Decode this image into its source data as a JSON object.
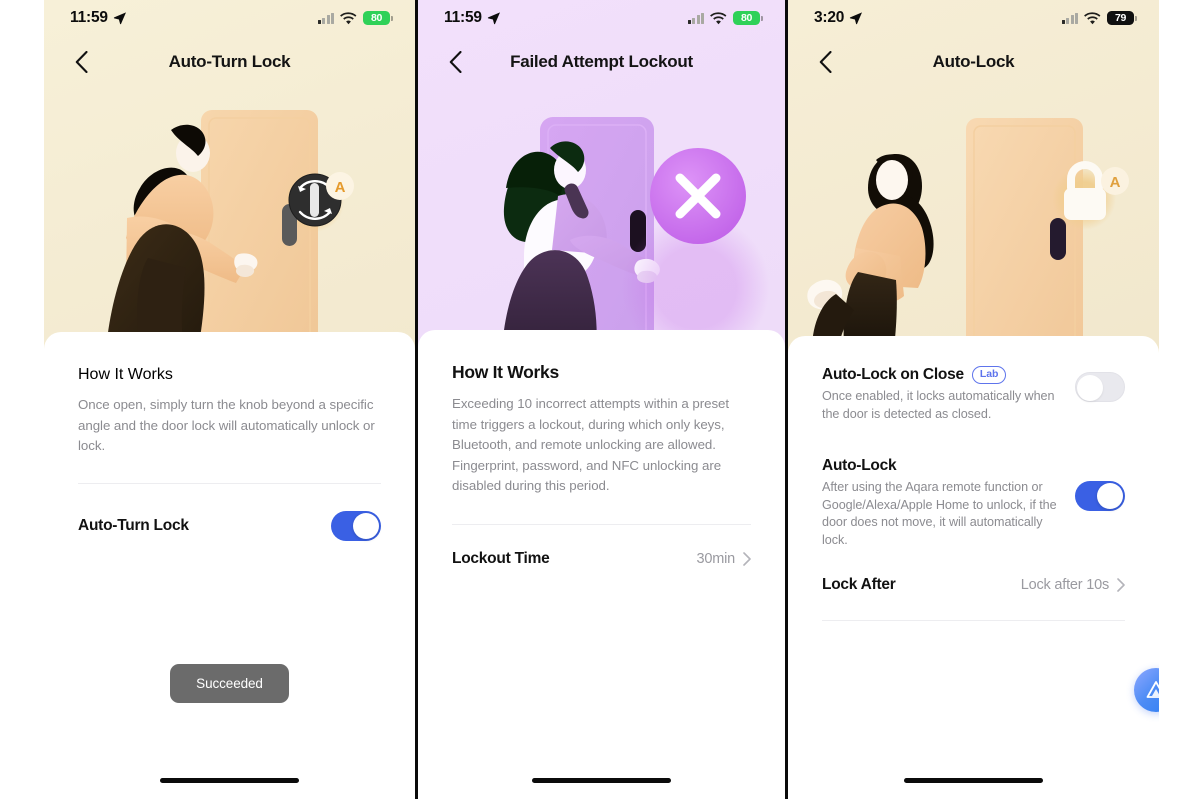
{
  "panels": [
    {
      "status": {
        "time": "11:59",
        "battery": "80",
        "battery_style": "green",
        "location_icon": "location-arrow-icon",
        "wifi_icon": "wifi-icon",
        "signal_icon": "cellular-signal-icon"
      },
      "nav": {
        "back_icon": "chevron-left-icon",
        "title": "Auto-Turn Lock"
      },
      "illustration": {
        "name": "person-turning-door-knob-illustration",
        "badge": "auto-turn-knob-badge",
        "badge_letter": "A"
      },
      "section": {
        "heading": "How It Works",
        "body": "Once open, simply turn the knob beyond a specific angle and the door lock will automatically unlock or lock."
      },
      "setting_row": {
        "label": "Auto-Turn Lock",
        "toggle_state": "on"
      },
      "toast": {
        "label": "Succeeded"
      },
      "colors": {
        "bg_top": "#f7f0d8",
        "bg_bottom": "#efe3c6",
        "toggle_on": "#3a60e4",
        "toast_bg": "#6b6b6b"
      }
    },
    {
      "status": {
        "time": "11:59",
        "battery": "80",
        "battery_style": "green",
        "location_icon": "location-arrow-icon",
        "wifi_icon": "wifi-icon",
        "signal_icon": "cellular-signal-icon"
      },
      "nav": {
        "back_icon": "chevron-left-icon",
        "title": "Failed Attempt Lockout"
      },
      "illustration": {
        "name": "person-blocked-at-door-illustration",
        "badge": "lockout-x-badge"
      },
      "section": {
        "heading": "How It Works",
        "body": "Exceeding 10 incorrect attempts within a preset time triggers a lockout, during which only keys, Bluetooth, and remote unlocking are allowed. Fingerprint, password, and NFC unlocking are disabled during this period."
      },
      "setting_row": {
        "label": "Lockout Time",
        "value": "30min",
        "chevron": "chevron-right-icon"
      },
      "colors": {
        "bg_top": "#f2e0fb",
        "bg_bottom": "#ecd9f7",
        "badge": "#c86ff0"
      }
    },
    {
      "status": {
        "time": "3:20",
        "battery": "79",
        "battery_style": "dark",
        "location_icon": "location-arrow-icon",
        "wifi_icon": "wifi-icon",
        "signal_icon": "cellular-signal-icon"
      },
      "nav": {
        "back_icon": "chevron-left-icon",
        "title": "Auto-Lock"
      },
      "illustration": {
        "name": "person-walking-away-from-locked-door-illustration",
        "badge": "auto-lock-padlock-badge",
        "badge_letter": "A"
      },
      "rows": [
        {
          "label": "Auto-Lock on Close",
          "badge": "Lab",
          "desc": "Once enabled, it locks automatically when the door is detected as closed.",
          "toggle_state": "off"
        },
        {
          "label": "Auto-Lock",
          "desc": "After using the Aqara remote function or Google/Alexa/Apple Home to unlock, if the door does not move, it will automatically lock.",
          "toggle_state": "on"
        }
      ],
      "link_row": {
        "label": "Lock After",
        "value": "Lock after 10s",
        "chevron": "chevron-right-icon"
      },
      "fab": {
        "name": "assistant-fab",
        "glyph": "triangle-logo-icon"
      },
      "colors": {
        "bg_top": "#f6eed6",
        "bg_bottom": "#eee2c2",
        "lab_badge": "#5e74ec",
        "toggle_on": "#3a60e4",
        "toggle_off": "#e9e9ee"
      }
    }
  ]
}
